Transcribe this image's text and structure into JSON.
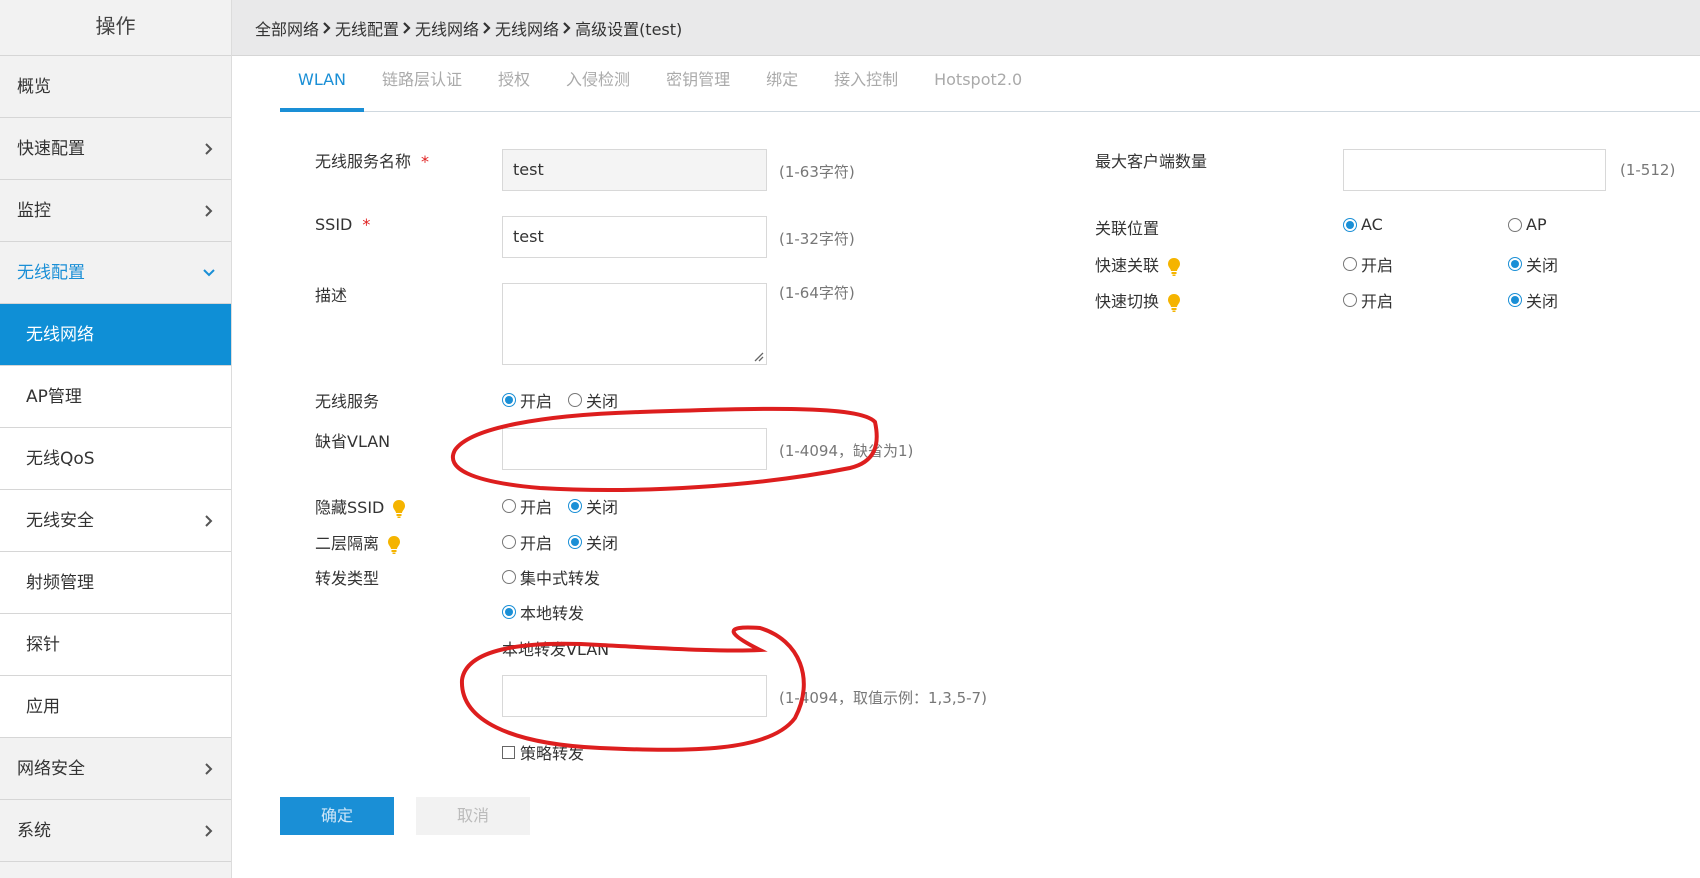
{
  "sidebar": {
    "title": "操作",
    "items": [
      {
        "label": "概览"
      },
      {
        "label": "快速配置"
      },
      {
        "label": "监控"
      },
      {
        "label": "无线配置"
      }
    ],
    "subitems": [
      {
        "label": "无线网络"
      },
      {
        "label": "AP管理"
      },
      {
        "label": "无线QoS"
      },
      {
        "label": "无线安全"
      },
      {
        "label": "射频管理"
      },
      {
        "label": "探针"
      },
      {
        "label": "应用"
      }
    ],
    "bottom_items": [
      {
        "label": "网络安全"
      },
      {
        "label": "系统"
      }
    ]
  },
  "breadcrumb": [
    "全部网络",
    "无线配置",
    "无线网络",
    "无线网络",
    "高级设置(test)"
  ],
  "tabs": [
    "WLAN",
    "链路层认证",
    "授权",
    "入侵检测",
    "密钥管理",
    "绑定",
    "接入控制",
    "Hotspot2.0"
  ],
  "form": {
    "service_name": {
      "label": "无线服务名称",
      "required": "*",
      "value": "test",
      "hint": "(1-63字符)"
    },
    "ssid": {
      "label": "SSID",
      "required": "*",
      "value": "test",
      "hint": "(1-32字符)"
    },
    "description": {
      "label": "描述",
      "hint": "(1-64字符)"
    },
    "wireless_service": {
      "label": "无线服务",
      "on": "开启",
      "off": "关闭"
    },
    "default_vlan": {
      "label": "缺省VLAN",
      "value": "",
      "hint": "(1-4094，缺省为1)"
    },
    "hide_ssid": {
      "label": "隐藏SSID",
      "on": "开启",
      "off": "关闭"
    },
    "l2_isolation": {
      "label": "二层隔离",
      "on": "开启",
      "off": "关闭"
    },
    "forward_type": {
      "label": "转发类型",
      "centralized": "集中式转发",
      "local": "本地转发"
    },
    "local_vlan": {
      "label": "本地转发VLAN",
      "value": "",
      "hint": "(1-4094，取值示例：1,3,5-7)"
    },
    "policy_forward": {
      "label": "策略转发"
    },
    "max_clients": {
      "label": "最大客户端数量",
      "value": "",
      "hint": "(1-512)"
    },
    "assoc_location": {
      "label": "关联位置",
      "ac": "AC",
      "ap": "AP"
    },
    "fast_assoc": {
      "label": "快速关联",
      "on": "开启",
      "off": "关闭"
    },
    "fast_switch": {
      "label": "快速切换",
      "on": "开启",
      "off": "关闭"
    }
  },
  "buttons": {
    "ok": "确定",
    "cancel": "取消"
  },
  "colors": {
    "accent": "#1a8fd6",
    "annotation": "#dd1e1e",
    "bulb": "#f5b400"
  }
}
